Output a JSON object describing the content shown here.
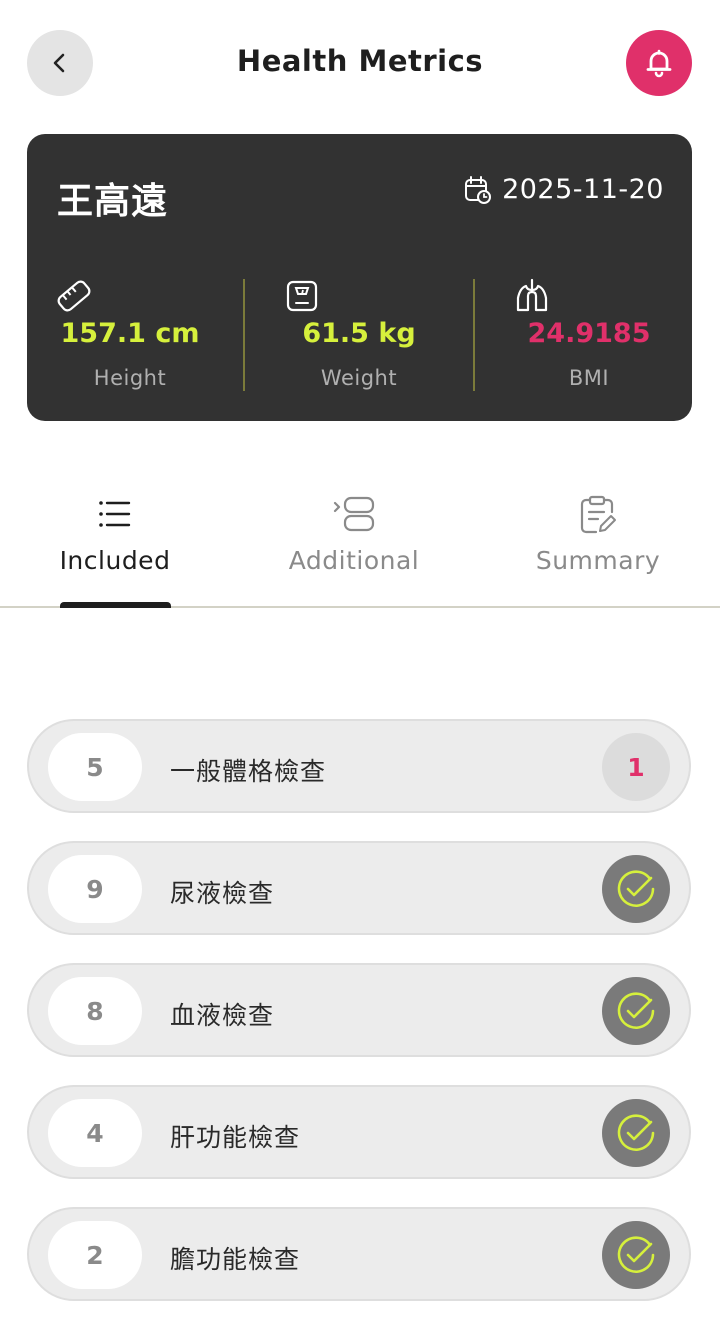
{
  "header": {
    "title": "Health Metrics",
    "back_icon": "chevron-left-icon",
    "notification_icon": "bell-icon"
  },
  "profile": {
    "name": "王高遠",
    "date": "2025-11-20",
    "date_icon": "calendar-clock-icon",
    "metrics": [
      {
        "icon": "ruler-icon",
        "value": "157.1 cm",
        "label": "Height"
      },
      {
        "icon": "scale-icon",
        "value": "61.5 kg",
        "label": "Weight"
      },
      {
        "icon": "lungs-icon",
        "value": "24.9185",
        "label": "BMI"
      }
    ]
  },
  "tabs": [
    {
      "icon": "list-icon",
      "label": "Included",
      "active": true
    },
    {
      "icon": "add-layers-icon",
      "label": "Additional",
      "active": false
    },
    {
      "icon": "clipboard-edit-icon",
      "label": "Summary",
      "active": false
    }
  ],
  "items": [
    {
      "count": "5",
      "label": "一般體格檢查",
      "status": "pending",
      "badge": "1"
    },
    {
      "count": "9",
      "label": "尿液檢查",
      "status": "done"
    },
    {
      "count": "8",
      "label": "血液檢查",
      "status": "done"
    },
    {
      "count": "4",
      "label": "肝功能檢查",
      "status": "done"
    },
    {
      "count": "2",
      "label": "膽功能檢查",
      "status": "done"
    }
  ],
  "colors": {
    "accent": "#e0306a",
    "highlight": "#d6f03c",
    "card_bg": "#323232"
  }
}
